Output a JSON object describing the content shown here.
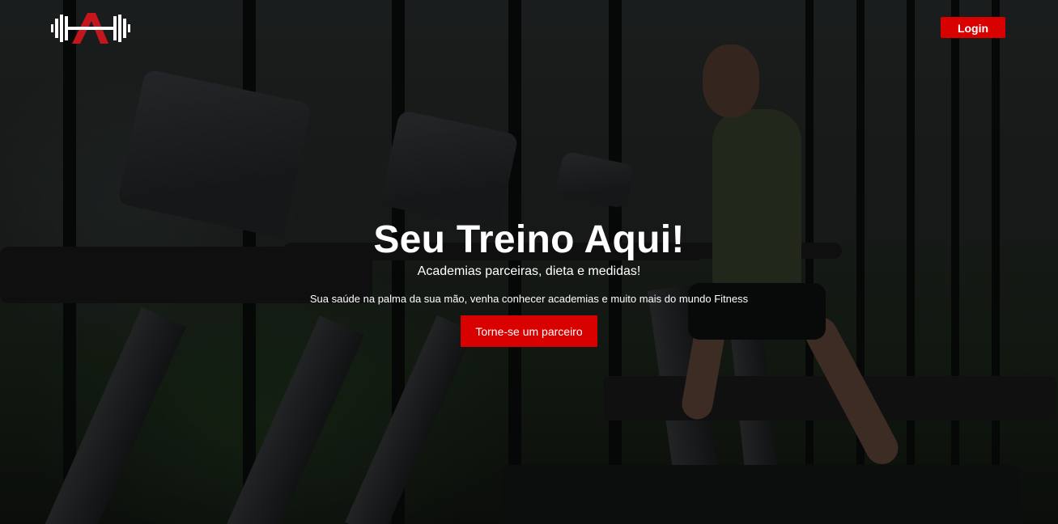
{
  "header": {
    "logo_icon": "dumbbell-a-logo",
    "login_label": "Login"
  },
  "hero": {
    "background_icon": "gym-treadmill-photo",
    "title": "Seu Treino Aqui!",
    "subtitle": "Academias parceiras, dieta e medidas!",
    "description": "Sua saúde na palma da sua mão, venha conhecer academias e muito mais do mundo Fitness",
    "cta_label": "Torne-se um parceiro"
  },
  "colors": {
    "accent": "#d90000",
    "text": "#ffffff",
    "logo_red": "#c4161c"
  }
}
